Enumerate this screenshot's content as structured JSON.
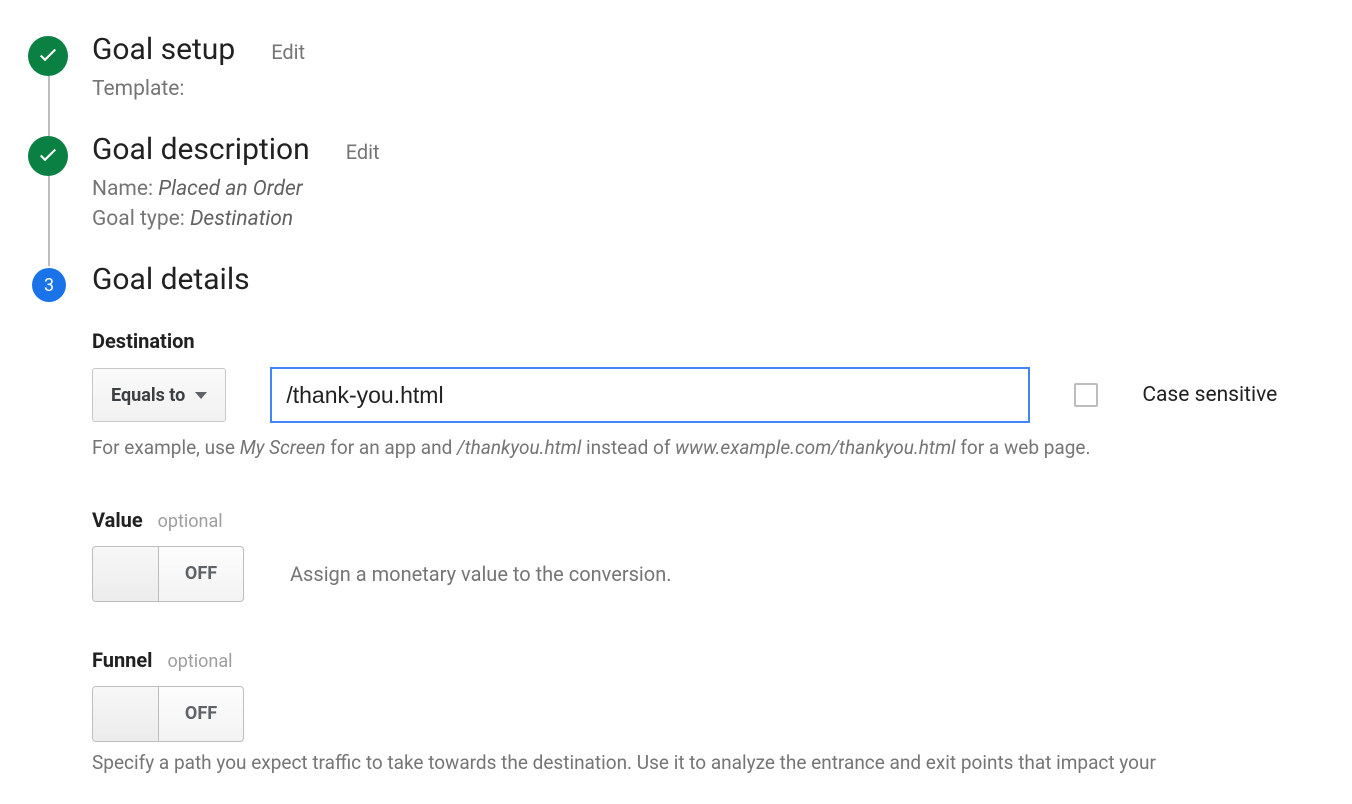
{
  "steps": {
    "setup": {
      "title": "Goal setup",
      "edit": "Edit",
      "summary_label": "Template:"
    },
    "description": {
      "title": "Goal description",
      "edit": "Edit",
      "name_label": "Name:",
      "name_value": "Placed an Order",
      "type_label": "Goal type:",
      "type_value": "Destination"
    },
    "details": {
      "number": "3",
      "title": "Goal details"
    }
  },
  "destination": {
    "section_label": "Destination",
    "match_type": "Equals to",
    "value": "/thank-you.html",
    "case_sensitive_label": "Case sensitive",
    "help_prefix": "For example, use ",
    "help_em1": "My Screen",
    "help_mid1": " for an app and ",
    "help_em2": "/thankyou.html",
    "help_mid2": " instead of ",
    "help_em3": "www.example.com/thankyou.html",
    "help_suffix": " for a web page."
  },
  "value": {
    "label": "Value",
    "optional": "optional",
    "toggle_state": "OFF",
    "description": "Assign a monetary value to the conversion."
  },
  "funnel": {
    "label": "Funnel",
    "optional": "optional",
    "toggle_state": "OFF",
    "description": "Specify a path you expect traffic to take towards the destination. Use it to analyze the entrance and exit points that impact your"
  }
}
